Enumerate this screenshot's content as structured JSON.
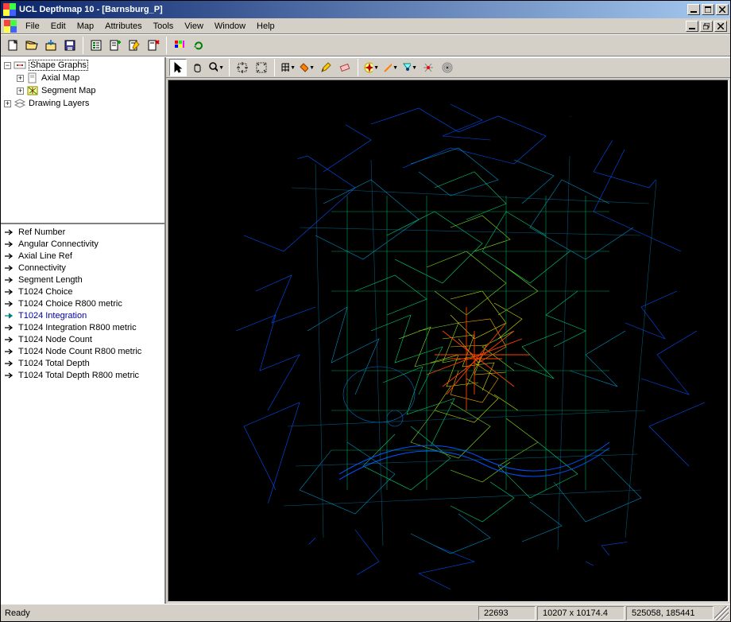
{
  "window": {
    "title": "UCL Depthmap 10 - [Barnsburg_P]"
  },
  "menu": {
    "items": [
      "File",
      "Edit",
      "Map",
      "Attributes",
      "Tools",
      "View",
      "Window",
      "Help"
    ]
  },
  "tree": {
    "items": [
      {
        "level": 0,
        "exp": "-",
        "icon": "shapegraphs",
        "label": "Shape Graphs",
        "sel": true
      },
      {
        "level": 1,
        "exp": "+",
        "icon": "doc",
        "label": "Axial Map"
      },
      {
        "level": 1,
        "exp": "+",
        "icon": "map",
        "label": "Segment Map"
      },
      {
        "level": 0,
        "exp": "+",
        "icon": "layers",
        "label": "Drawing Layers"
      }
    ]
  },
  "attributes": {
    "items": [
      "Ref Number",
      "Angular Connectivity",
      "Axial Line Ref",
      "Connectivity",
      "Segment Length",
      "T1024 Choice",
      "T1024 Choice R800 metric",
      "T1024 Integration",
      "T1024 Integration R800 metric",
      "T1024 Node Count",
      "T1024 Node Count R800 metric",
      "T1024 Total Depth",
      "T1024 Total Depth R800 metric"
    ],
    "selected_index": 7
  },
  "status": {
    "ready": "Ready",
    "count": "22693",
    "dimensions": "10207 x 10174.4",
    "coords": "525058, 185441"
  }
}
